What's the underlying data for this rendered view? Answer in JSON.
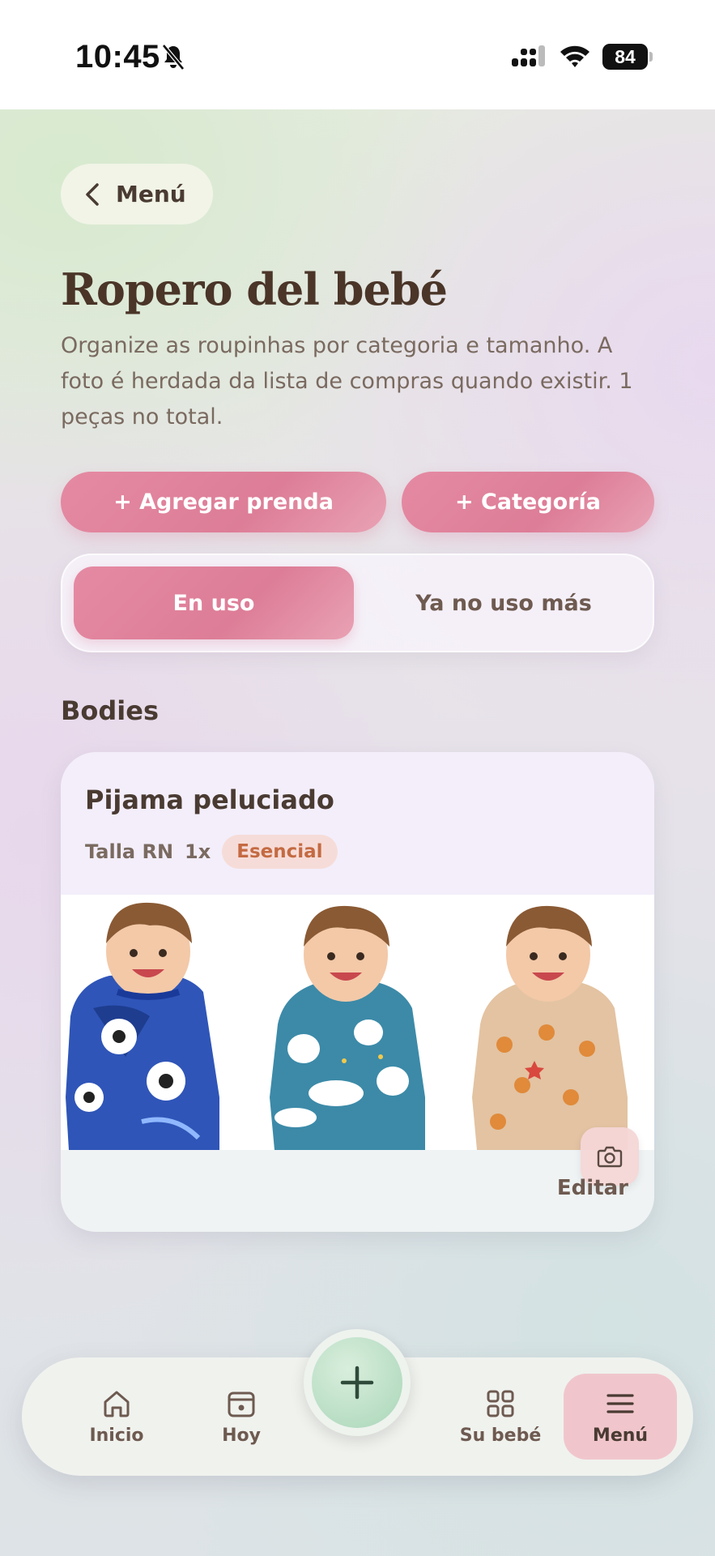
{
  "status_bar": {
    "time": "10:45",
    "battery": "84"
  },
  "nav": {
    "back_label": "Menú"
  },
  "page": {
    "title": "Ropero del bebé",
    "description": "Organize as roupinhas por categoria e tamanho. A foto é herdada da lista de compras quando existir. 1 peças no total."
  },
  "actions": {
    "add_item": "+ Agregar prenda",
    "add_category": "+ Categoría"
  },
  "filter": {
    "active": "En uso",
    "inactive": "Ya no uso más"
  },
  "sections": [
    {
      "title": "Bodies",
      "items": [
        {
          "name": "Pijama peluciado",
          "size": "Talla RN",
          "quantity": "1x",
          "badge": "Esencial",
          "edit_label": "Editar"
        }
      ]
    }
  ],
  "tabbar": {
    "items": [
      {
        "label": "Inicio",
        "icon": "home-icon"
      },
      {
        "label": "Hoy",
        "icon": "calendar-icon"
      },
      {
        "label": "Su bebé",
        "icon": "grid-icon"
      },
      {
        "label": "Menú",
        "icon": "menu-icon"
      }
    ],
    "fab_icon": "plus-icon"
  },
  "colors": {
    "accent_pink": "#DD7D97",
    "badge_bg": "#F6DCD8",
    "badge_text": "#C46A42",
    "fab_green": "#A9D6B8",
    "text_dark": "#4A3B32"
  }
}
